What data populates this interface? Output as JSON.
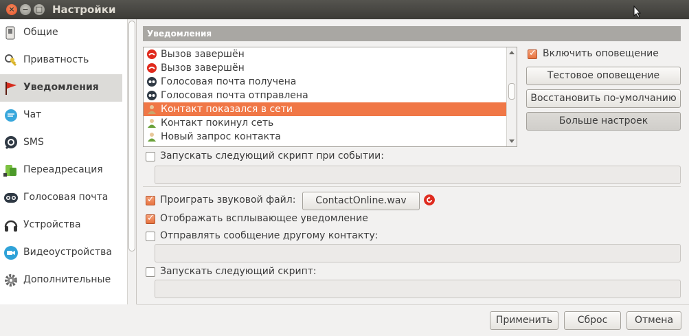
{
  "window": {
    "title": "Настройки",
    "close_glyph": "×",
    "minimize_glyph": "−",
    "maximize_glyph": "□"
  },
  "sidebar": {
    "items": [
      {
        "label": "Общие",
        "icon": "switch-icon"
      },
      {
        "label": "Приватность",
        "icon": "keys-icon"
      },
      {
        "label": "Уведомления",
        "icon": "flag-icon",
        "active": true
      },
      {
        "label": "Чат",
        "icon": "chat-icon"
      },
      {
        "label": "SMS",
        "icon": "sms-icon"
      },
      {
        "label": "Переадресация",
        "icon": "forward-icon"
      },
      {
        "label": "Голосовая почта",
        "icon": "voicemail-icon"
      },
      {
        "label": "Устройства",
        "icon": "headset-icon"
      },
      {
        "label": "Видеоустройства",
        "icon": "camera-icon"
      },
      {
        "label": "Дополнительные",
        "icon": "gear-icon"
      }
    ]
  },
  "notifications": {
    "header": "Уведомления",
    "events": [
      {
        "label": "Вызов завершён",
        "icon": "hangup-icon"
      },
      {
        "label": "Вызов завершён",
        "icon": "hangup-icon"
      },
      {
        "label": "Голосовая почта получена",
        "icon": "voicemail-icon"
      },
      {
        "label": "Голосовая почта отправлена",
        "icon": "voicemail-icon"
      },
      {
        "label": "Контакт показался в сети",
        "icon": "contact-icon",
        "selected": true
      },
      {
        "label": "Контакт покинул сеть",
        "icon": "contact-icon"
      },
      {
        "label": "Новый запрос контакта",
        "icon": "contact-icon"
      }
    ],
    "enable_label": "Включить оповещение",
    "enable_checked": true,
    "test_button": "Тестовое оповещение",
    "restore_button": "Восстановить по-умолчанию",
    "more_button": "Больше настроек",
    "run_script_on_event_label": "Запускать следующий скрипт при событии:",
    "run_script_on_event_checked": false,
    "run_script_on_event_value": "",
    "play_sound_label": "Проиграть звуковой файл:",
    "play_sound_checked": true,
    "sound_file": "ContactOnline.wav",
    "popup_label": "Отображать всплывающее уведомление",
    "popup_checked": true,
    "send_message_label": "Отправлять сообщение другому контакту:",
    "send_message_checked": false,
    "send_message_value": "",
    "run_script_label": "Запускать следующий скрипт:",
    "run_script_checked": false,
    "run_script_value": ""
  },
  "footer": {
    "apply": "Применить",
    "reset": "Сброс",
    "cancel": "Отмена"
  },
  "colors": {
    "accent": "#f07746",
    "header_bg": "#a9a7a3",
    "titlebar": "#3c3b37"
  }
}
